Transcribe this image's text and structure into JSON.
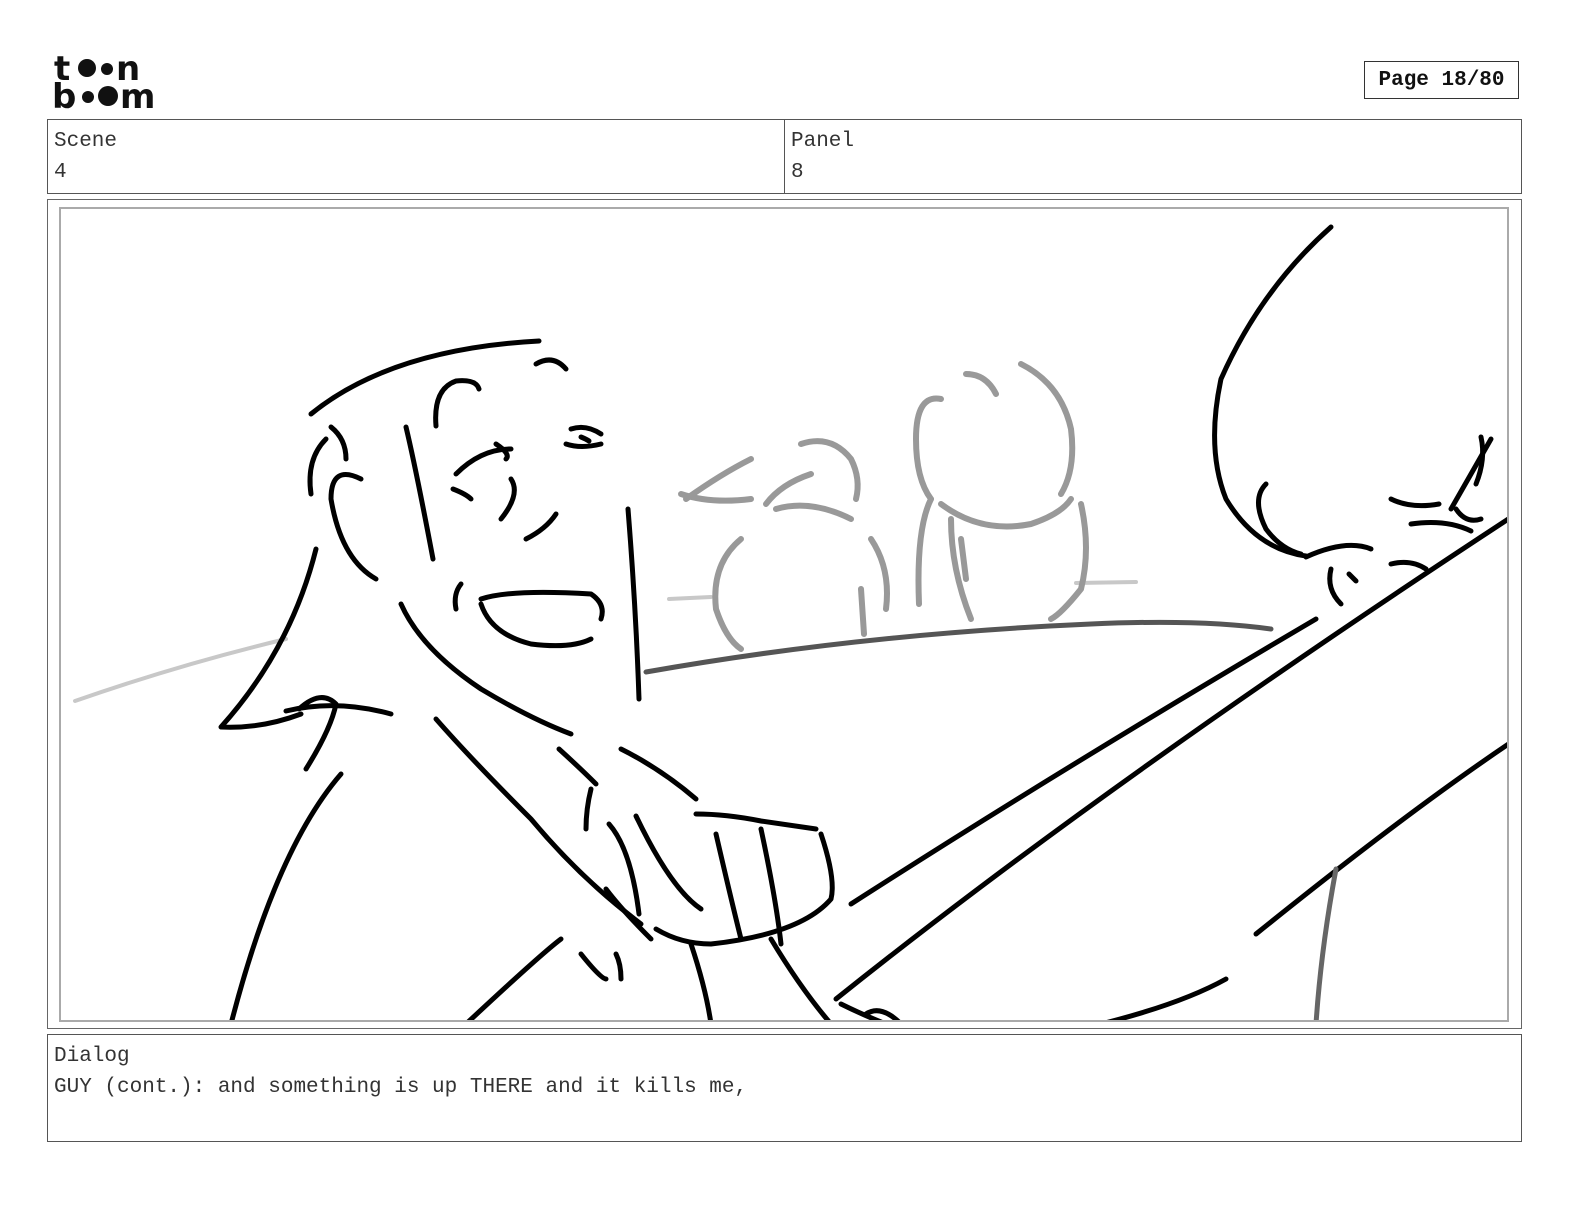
{
  "header": {
    "logo_text": "toon boom",
    "page_label": "Page 18/80"
  },
  "info": {
    "scene_label": "Scene",
    "scene_value": "4",
    "panel_label": "Panel",
    "panel_value": "8"
  },
  "dialog": {
    "label": "Dialog",
    "text": "GUY (cont.): and something is up THERE and it kills me,"
  },
  "colors": {
    "ink": "#000000",
    "ink_mid": "#666666",
    "ink_light": "#999999",
    "frame": "#aaaaaa"
  }
}
